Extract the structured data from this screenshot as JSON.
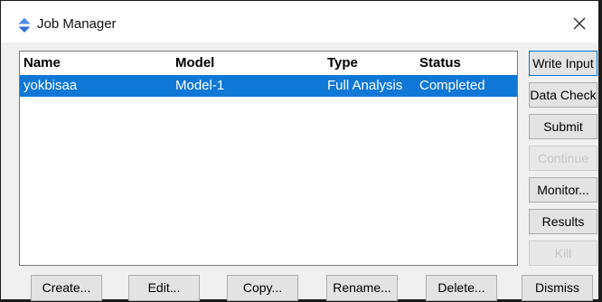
{
  "window": {
    "title": "Job Manager",
    "icon": "abaqus-diamond-icon",
    "close_icon": "close-icon"
  },
  "job_list": {
    "columns": [
      "Name",
      "Model",
      "Type",
      "Status"
    ],
    "rows": [
      {
        "name": "yokbisaa",
        "model": "Model-1",
        "type": "Full Analysis",
        "status": "Completed",
        "selected": true
      }
    ]
  },
  "side_buttons": [
    {
      "label": "Write Input",
      "enabled": true,
      "focused": true
    },
    {
      "label": "Data Check",
      "enabled": true
    },
    {
      "label": "Submit",
      "enabled": true
    },
    {
      "label": "Continue",
      "enabled": false
    },
    {
      "label": "Monitor...",
      "enabled": true
    },
    {
      "label": "Results",
      "enabled": true
    },
    {
      "label": "Kill",
      "enabled": false
    }
  ],
  "bottom_buttons": [
    {
      "label": "Create..."
    },
    {
      "label": "Edit..."
    },
    {
      "label": "Copy..."
    },
    {
      "label": "Rename..."
    },
    {
      "label": "Delete..."
    },
    {
      "label": "Dismiss"
    }
  ],
  "colors": {
    "selection": "#0f78d7",
    "focus_border": "#0078d7",
    "disabled_text": "#c6c6c6"
  }
}
